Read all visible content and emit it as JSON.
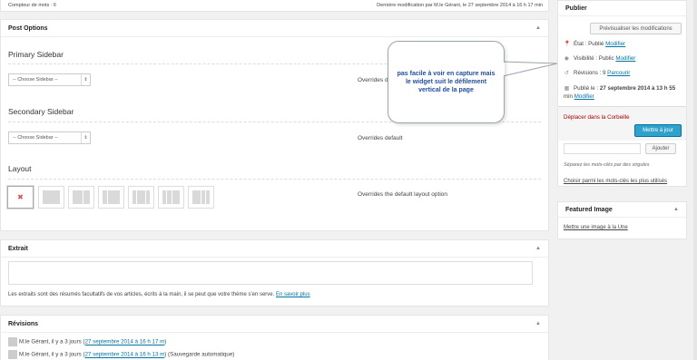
{
  "topbar": {
    "word_count": "Compteur de mots : 6",
    "last_modified": "Dernière modification par M.le Gérant, le 27 septembre 2014 à 16 h 17 min"
  },
  "post_options": {
    "title": "Post Options",
    "primary_sidebar": {
      "heading": "Primary Sidebar",
      "select": "-- Choose Sidebar --",
      "note": "Overrides default"
    },
    "secondary_sidebar": {
      "heading": "Secondary Sidebar",
      "select": "-- Choose Sidebar --",
      "note": "Overrides default"
    },
    "layout": {
      "heading": "Layout",
      "note": "Overrides the default layout option",
      "remove_glyph": "✖"
    }
  },
  "excerpt": {
    "title": "Extrait",
    "help": "Les extraits sont des résumés facultatifs de vos articles, écrits à la main, il se peut que votre thème s'en serve.",
    "learn_more": "En savoir plus"
  },
  "revisions": {
    "title": "Révisions",
    "items": [
      {
        "author": "M.le Gérant, il y a 3 jours (",
        "link": "27 septembre 2014 à 16 h 17 m",
        "suffix": ")"
      },
      {
        "author": "M.le Gérant, il y a 3 jours (",
        "link": "27 septembre 2014 à 16 h 13 m",
        "suffix": ") (Sauvegarde automatique)"
      }
    ]
  },
  "publish": {
    "title": "Publier",
    "preview_button": "Prévisualiser les modifications",
    "status_label": "État : Publié",
    "status_edit": "Modifier",
    "visibility_label": "Visibilité : Public",
    "visibility_edit": "Modifier",
    "revisions_label": "Révisions : 9",
    "revisions_browse": "Parcourir",
    "published_prefix": "Publié le :",
    "published_date": "27 septembre 2014 à 13 h 55",
    "published_min": "min",
    "published_edit": "Modifier",
    "trash_link": "Déplacer dans la Corbeille",
    "update_button": "Mettre à jour"
  },
  "tags": {
    "add_button": "Ajouter",
    "hint": "Séparez les mots-clés par des virgules",
    "choose_link": "Choisir parmi les mots-clés les plus utilisés"
  },
  "featured_image": {
    "title": "Featured Image",
    "set_link": "Mettre une image à la Une"
  },
  "callout": {
    "text": "pas facile à voir en capture mais  le widget suit le défilement vertical de la page"
  },
  "icons": [
    "pin-icon",
    "eye-icon",
    "history-icon",
    "calendar-icon",
    "collapse-arrow-icon",
    "close-icon"
  ],
  "colors": {
    "link": "#0074a2",
    "primary_button": "#2ea2cc",
    "trash": "#a00",
    "callout_text": "#1f4e9c"
  }
}
